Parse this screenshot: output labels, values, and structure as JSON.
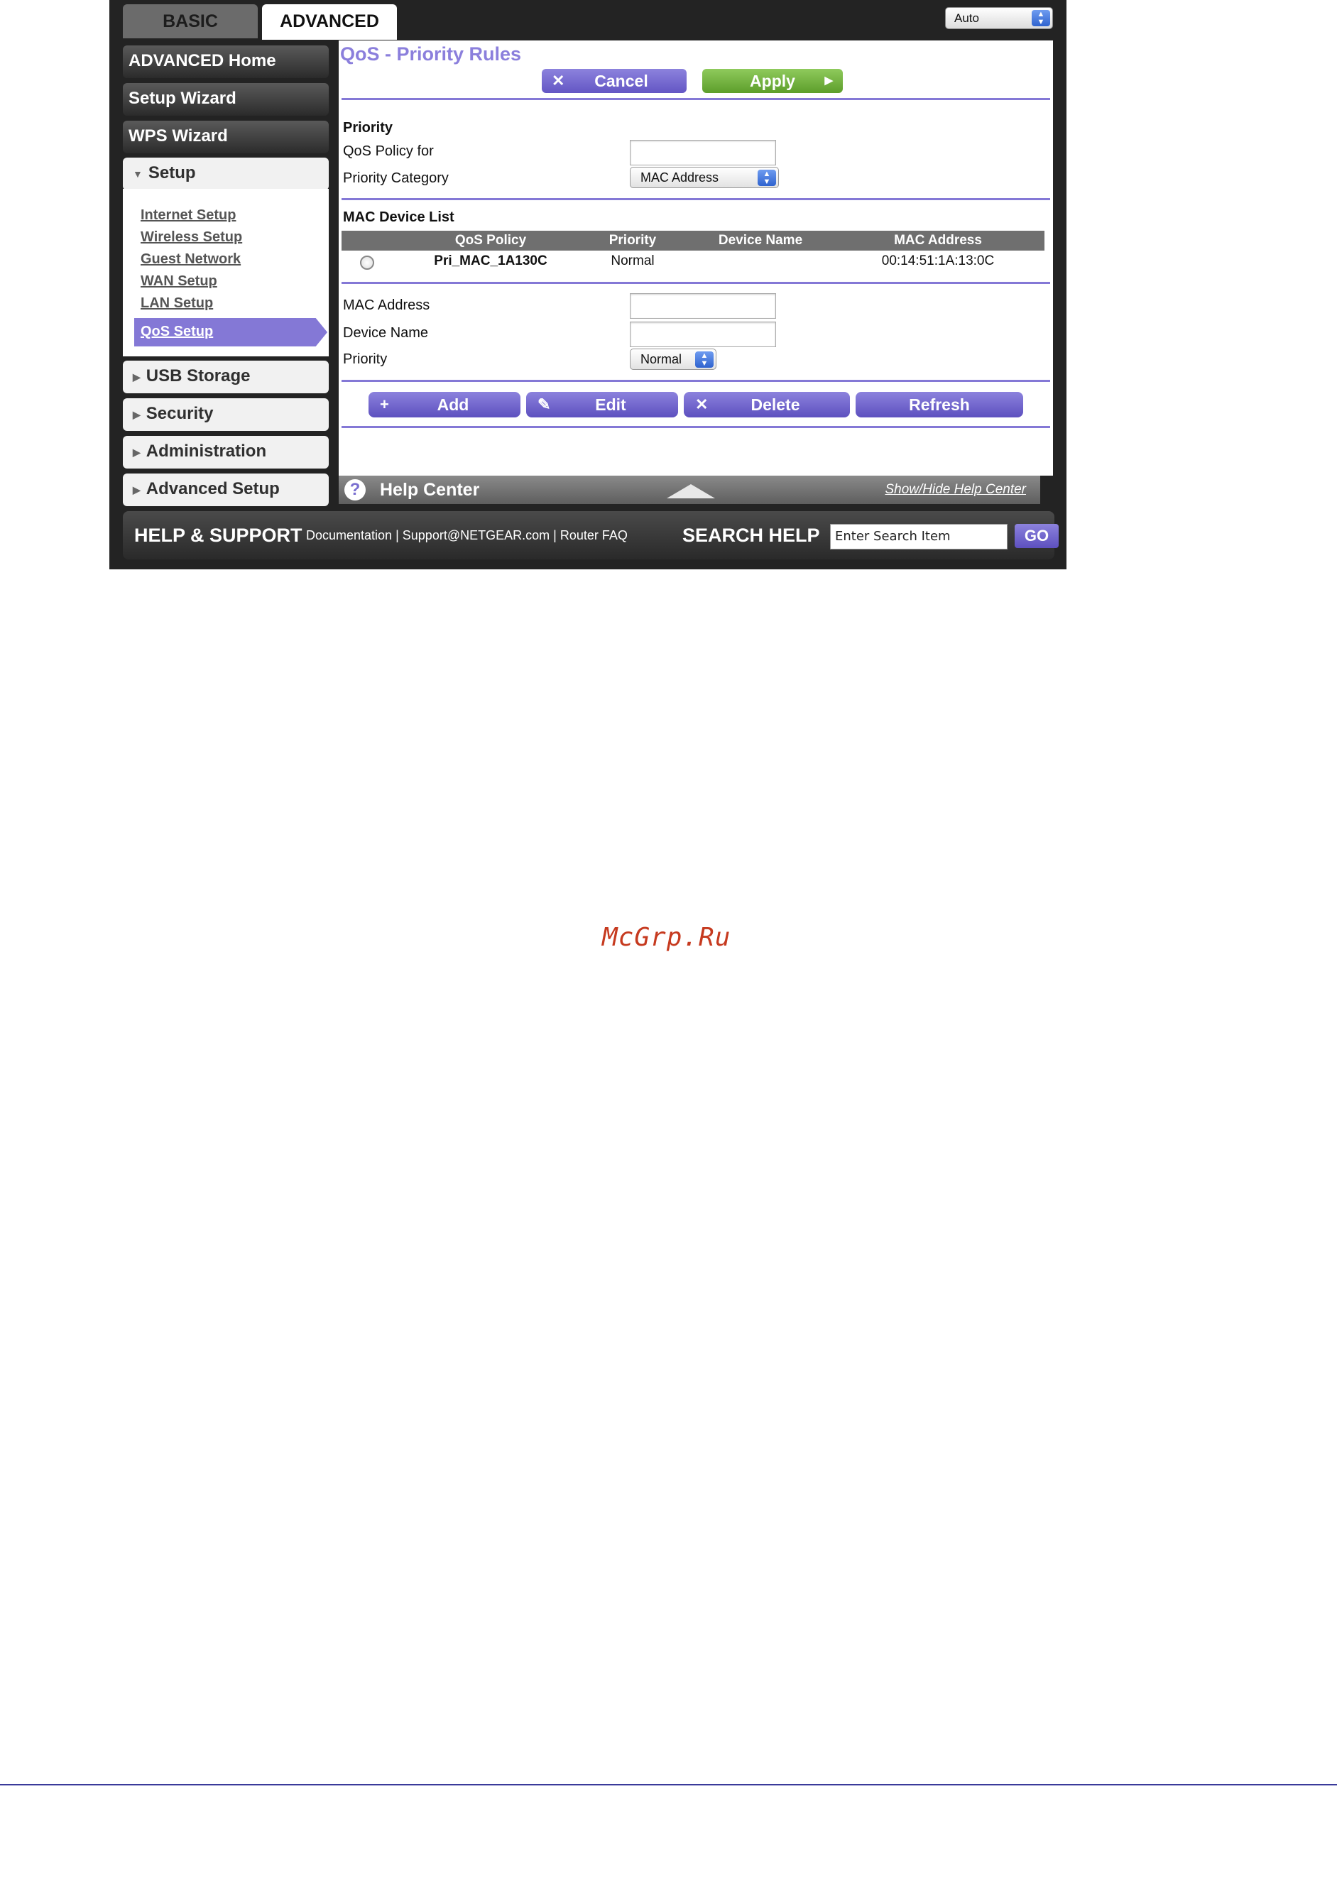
{
  "tabs": {
    "basic": "BASIC",
    "advanced": "ADVANCED"
  },
  "language_select": {
    "value": "Auto"
  },
  "sidebar": {
    "advanced_home": "ADVANCED Home",
    "setup_wizard": "Setup Wizard",
    "wps_wizard": "WPS Wizard",
    "setup": "Setup",
    "setup_items": [
      "Internet Setup",
      "Wireless Setup",
      "Guest Network",
      "WAN Setup",
      "LAN Setup",
      "QoS Setup"
    ],
    "usb_storage": "USB Storage",
    "security": "Security",
    "administration": "Administration",
    "advanced_setup": "Advanced Setup"
  },
  "page": {
    "title": "QoS - Priority Rules",
    "cancel": "Cancel",
    "apply": "Apply"
  },
  "priority_section": {
    "heading": "Priority",
    "qos_policy_label": "QoS Policy for",
    "qos_policy_value": "",
    "category_label": "Priority Category",
    "category_value": "MAC Address"
  },
  "mac_list": {
    "heading": "MAC Device List",
    "columns": [
      "QoS Policy",
      "Priority",
      "Device Name",
      "MAC Address"
    ],
    "rows": [
      {
        "qos_policy": "Pri_MAC_1A130C",
        "priority": "Normal",
        "device_name": "",
        "mac_address": "00:14:51:1A:13:0C"
      }
    ]
  },
  "device_form": {
    "mac_label": "MAC Address",
    "mac_value": "",
    "name_label": "Device Name",
    "name_value": "",
    "priority_label": "Priority",
    "priority_value": "Normal"
  },
  "actions": {
    "add": "Add",
    "edit": "Edit",
    "delete": "Delete",
    "refresh": "Refresh"
  },
  "help_center": {
    "label": "Help Center",
    "toggle": "Show/Hide Help Center"
  },
  "footer": {
    "title": "HELP & SUPPORT",
    "links": [
      "Documentation",
      "Support@NETGEAR.com",
      "Router FAQ"
    ],
    "search_label": "SEARCH HELP",
    "search_value": "Enter Search Item",
    "go": "GO"
  },
  "watermark": "McGrp.Ru"
}
